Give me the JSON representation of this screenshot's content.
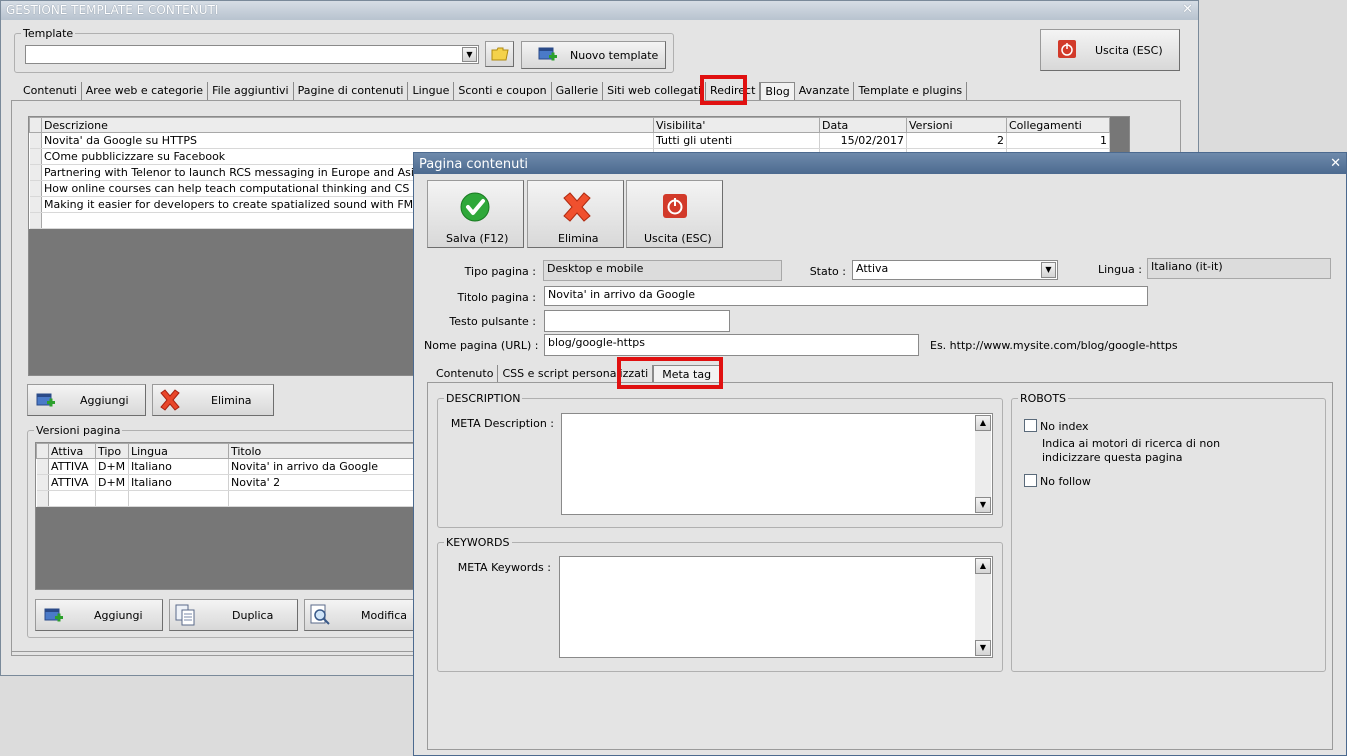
{
  "main_window": {
    "title": "GESTIONE TEMPLATE E CONTENUTI",
    "close_glyph": "✕",
    "template_group_label": "Template",
    "template_value": "",
    "nuovo_template_label": "Nuovo template",
    "uscita_label": "Uscita (ESC)",
    "tabs": [
      {
        "label": "Contenuti"
      },
      {
        "label": "Aree web e categorie"
      },
      {
        "label": "File aggiuntivi"
      },
      {
        "label": "Pagine di contenuti"
      },
      {
        "label": "Lingue"
      },
      {
        "label": "Sconti e coupon"
      },
      {
        "label": "Gallerie"
      },
      {
        "label": "Siti web collegati"
      },
      {
        "label": "Redirect"
      },
      {
        "label": "Blog"
      },
      {
        "label": "Avanzate"
      },
      {
        "label": "Template e plugins"
      }
    ],
    "selected_tab": "Blog",
    "posts_grid": {
      "columns": [
        "Descrizione",
        "Visibilita'",
        "Data",
        "Versioni",
        "Collegamenti"
      ],
      "rows": [
        {
          "descrizione": "Novita' da Google su HTTPS",
          "visibilita": "Tutti gli utenti",
          "data": "15/02/2017",
          "versioni": "2",
          "collegamenti": "1"
        },
        {
          "descrizione": "COme pubblicizzare su Facebook",
          "visibilita": "",
          "data": "",
          "versioni": "",
          "collegamenti": ""
        },
        {
          "descrizione": "Partnering with Telenor to launch RCS messaging in Europe and Asia",
          "visibilita": "",
          "data": "",
          "versioni": "",
          "collegamenti": ""
        },
        {
          "descrizione": "How online courses can help teach computational thinking and CS",
          "visibilita": "",
          "data": "",
          "versioni": "",
          "collegamenti": ""
        },
        {
          "descrizione": "Making it easier for developers to create spatialized sound with FMOD and Wu",
          "visibilita": "",
          "data": "",
          "versioni": "",
          "collegamenti": ""
        }
      ]
    },
    "aggiungi_label": "Aggiungi",
    "elimina_label": "Elimina",
    "versioni_group_label": "Versioni pagina",
    "versions_grid": {
      "columns": [
        "Attiva",
        "Tipo",
        "Lingua",
        "Titolo"
      ],
      "rows": [
        {
          "attiva": "ATTIVA",
          "tipo": "D+M",
          "lingua": "Italiano",
          "titolo": "Novita' in arrivo da Google"
        },
        {
          "attiva": "ATTIVA",
          "tipo": "D+M",
          "lingua": "Italiano",
          "titolo": "Novita' 2"
        }
      ]
    },
    "aggiungi2_label": "Aggiungi",
    "duplica_label": "Duplica",
    "modifica_label": "Modifica"
  },
  "dialog": {
    "title": "Pagina contenuti",
    "close_glyph": "✕",
    "toolbar": {
      "salva_label": "Salva (F12)",
      "elimina_label": "Elimina",
      "uscita_label": "Uscita (ESC)"
    },
    "fields": {
      "tipo_pagina_label": "Tipo pagina :",
      "tipo_pagina_value": "Desktop e mobile",
      "stato_label": "Stato :",
      "stato_value": "Attiva",
      "lingua_label": "Lingua :",
      "lingua_value": "Italiano (it-it)",
      "titolo_label": "Titolo pagina :",
      "titolo_value": "Novita' in arrivo da Google",
      "testo_pulsante_label": "Testo pulsante :",
      "testo_pulsante_value": "",
      "nome_pagina_label": "Nome pagina (URL) :",
      "nome_pagina_value": "blog/google-https",
      "url_example": "Es. http://www.mysite.com/blog/google-https"
    },
    "tabs": [
      {
        "label": "Contenuto"
      },
      {
        "label": "CSS e script personalizzati"
      },
      {
        "label": "Meta tag"
      }
    ],
    "selected_tab": "Meta tag",
    "description_group": "DESCRIPTION",
    "meta_description_label": "META Description :",
    "meta_description_value": "",
    "keywords_group": "KEYWORDS",
    "meta_keywords_label": "META Keywords :",
    "meta_keywords_value": "",
    "robots_group": "ROBOTS",
    "no_index_label": "No index",
    "no_index_checked": false,
    "no_index_hint": "Indica ai motori di ricerca di non indicizzare questa pagina",
    "no_follow_label": "No follow",
    "no_follow_checked": false
  },
  "colors": {
    "highlight_red": "#e01010",
    "active_title": "#4c6a8f",
    "grid_empty": "#777777"
  }
}
